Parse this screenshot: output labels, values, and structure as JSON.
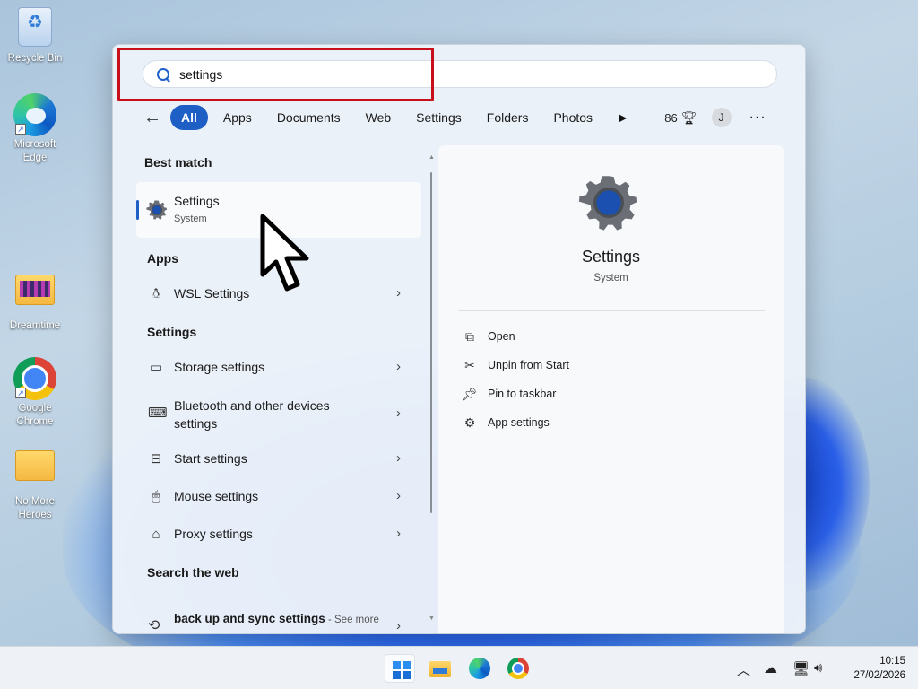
{
  "desktop": {
    "icons": [
      {
        "label": "Recycle Bin"
      },
      {
        "label": "Microsoft Edge"
      },
      {
        "label": "Dreamtime"
      },
      {
        "label": "Google Chrome"
      },
      {
        "label": "No More Heroes"
      }
    ]
  },
  "search": {
    "query": "settings"
  },
  "filters": {
    "tabs": [
      {
        "label": "All",
        "active": true
      },
      {
        "label": "Apps"
      },
      {
        "label": "Documents"
      },
      {
        "label": "Web"
      },
      {
        "label": "Settings"
      },
      {
        "label": "Folders"
      },
      {
        "label": "Photos"
      }
    ],
    "points": "86",
    "avatar_initial": "J"
  },
  "results": {
    "best_match_heading": "Best match",
    "best_match": {
      "title": "Settings",
      "subtitle": "System"
    },
    "apps_heading": "Apps",
    "apps": [
      {
        "label": "WSL Settings"
      }
    ],
    "settings_heading": "Settings",
    "settings": [
      {
        "label": "Storage settings"
      },
      {
        "label": "Bluetooth and other devices settings"
      },
      {
        "label": "Start settings"
      },
      {
        "label": "Mouse settings"
      },
      {
        "label": "Proxy settings"
      }
    ],
    "web_heading": "Search the web",
    "web": {
      "query_bold": "back up and sync settings",
      "suffix": " - See more search results"
    }
  },
  "preview": {
    "title": "Settings",
    "subtitle": "System",
    "actions": [
      {
        "label": "Open",
        "icon": "open-external-icon"
      },
      {
        "label": "Unpin from Start",
        "icon": "unpin-icon"
      },
      {
        "label": "Pin to taskbar",
        "icon": "pin-icon"
      },
      {
        "label": "App settings",
        "icon": "gear-icon"
      }
    ]
  },
  "taskbar": {
    "time": "10:15",
    "date": "27/02/2026"
  },
  "colors": {
    "accent": "#1e5fc6",
    "highlight_box": "#c8101c"
  }
}
